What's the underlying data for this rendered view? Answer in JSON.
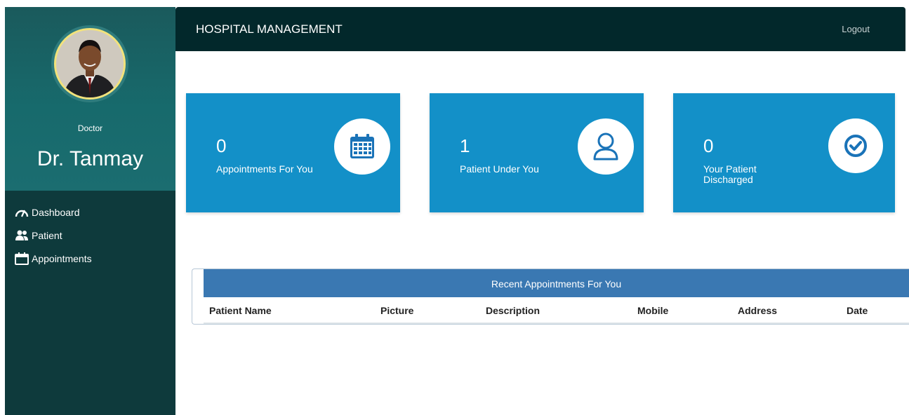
{
  "sidebar": {
    "role": "Doctor",
    "name": "Dr. Tanmay",
    "items": [
      {
        "label": "Dashboard",
        "icon": "speedometer-icon"
      },
      {
        "label": "Patient",
        "icon": "users-icon"
      },
      {
        "label": "Appointments",
        "icon": "calendar-icon"
      }
    ]
  },
  "header": {
    "title": "HOSPITAL MANAGEMENT",
    "logout": "Logout"
  },
  "cards": [
    {
      "value": "0",
      "label": "Appointments For You",
      "icon": "calendar-grid-icon"
    },
    {
      "value": "1",
      "label": "Patient Under You",
      "icon": "user-outline-icon"
    },
    {
      "value": "0",
      "label": "Your Patient Discharged",
      "icon": "check-circle-icon"
    }
  ],
  "appointments": {
    "title": "Recent Appointments For You",
    "columns": [
      "Patient Name",
      "Picture",
      "Description",
      "Mobile",
      "Address",
      "Date"
    ]
  },
  "colors": {
    "sidebar": "#0e3a3c",
    "header": "#02282b",
    "card": "#1390c8",
    "table_header": "#3a78b2"
  }
}
